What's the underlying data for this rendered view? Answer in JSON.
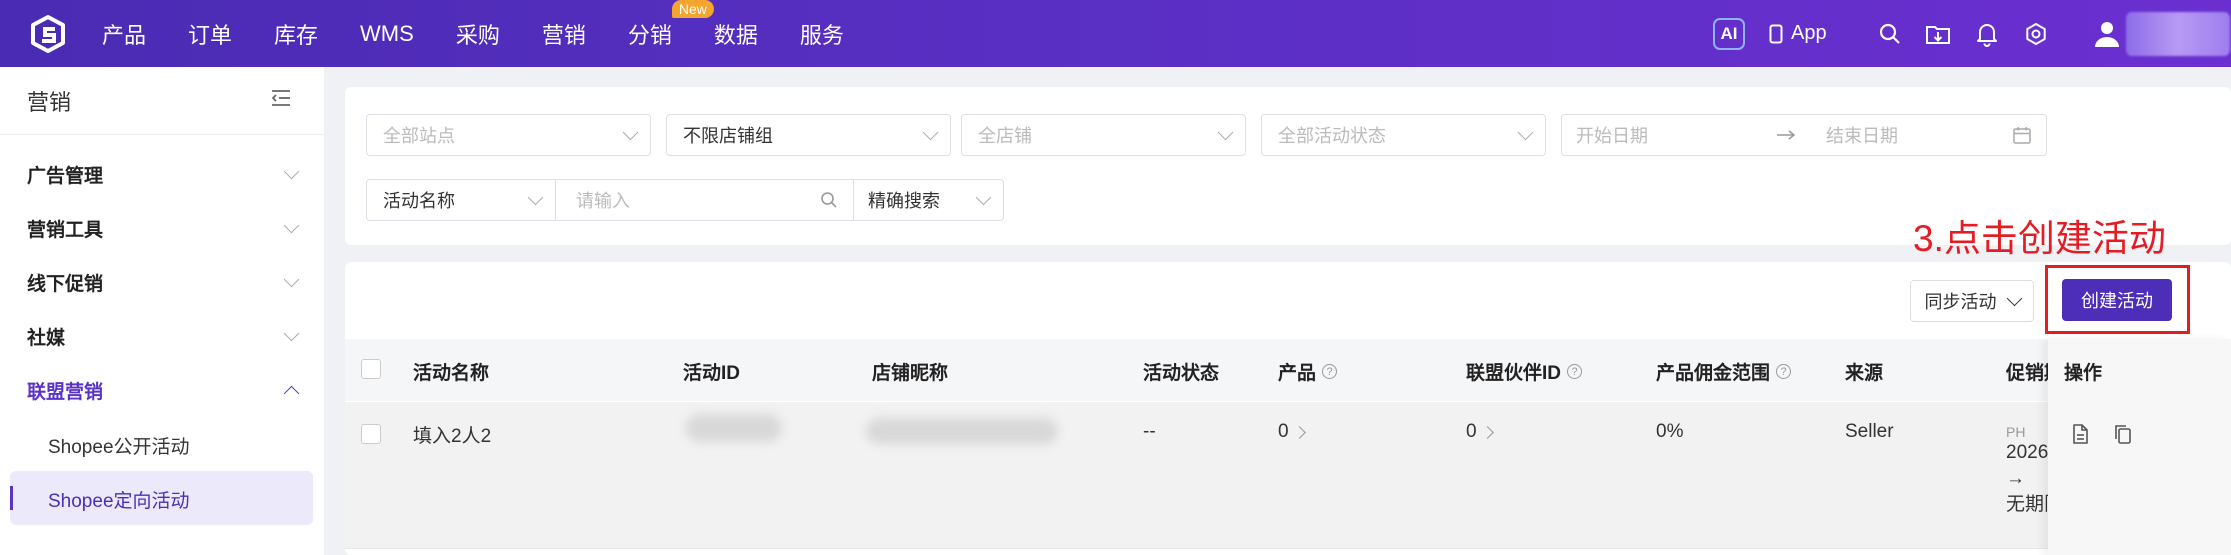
{
  "topbar": {
    "nav": [
      "产品",
      "订单",
      "库存",
      "WMS",
      "采购",
      "营销",
      "分销",
      "数据",
      "服务"
    ],
    "new_badge": "New",
    "ai_label": "AI",
    "app_label": "App"
  },
  "sidebar": {
    "title": "营销",
    "groups": [
      "广告管理",
      "营销工具",
      "线下促销",
      "社媒",
      "联盟营销"
    ],
    "sub_items": [
      "Shopee公开活动",
      "Shopee定向活动"
    ]
  },
  "filters": {
    "site_placeholder": "全部站点",
    "shop_group": "不限店铺组",
    "shop_placeholder": "全店铺",
    "status_placeholder": "全部活动状态",
    "start_date_placeholder": "开始日期",
    "end_date_placeholder": "结束日期",
    "name_field": "活动名称",
    "search_placeholder": "请输入",
    "search_mode": "精确搜索"
  },
  "toolbar": {
    "sync_label": "同步活动",
    "create_label": "创建活动",
    "annotation": "3.点击创建活动"
  },
  "table": {
    "columns": [
      "活动名称",
      "活动ID",
      "店铺昵称",
      "活动状态",
      "产品",
      "联盟伙伴ID",
      "产品佣金范围",
      "来源",
      "促销期",
      "操作"
    ],
    "row": {
      "name": "填入2人2",
      "status": "--",
      "products": "0",
      "partner_id": "0",
      "commission": "0%",
      "source": "Seller",
      "promo_tag": "PH",
      "promo_start": "2026",
      "promo_arrow": "→",
      "promo_end": "无期限"
    }
  }
}
